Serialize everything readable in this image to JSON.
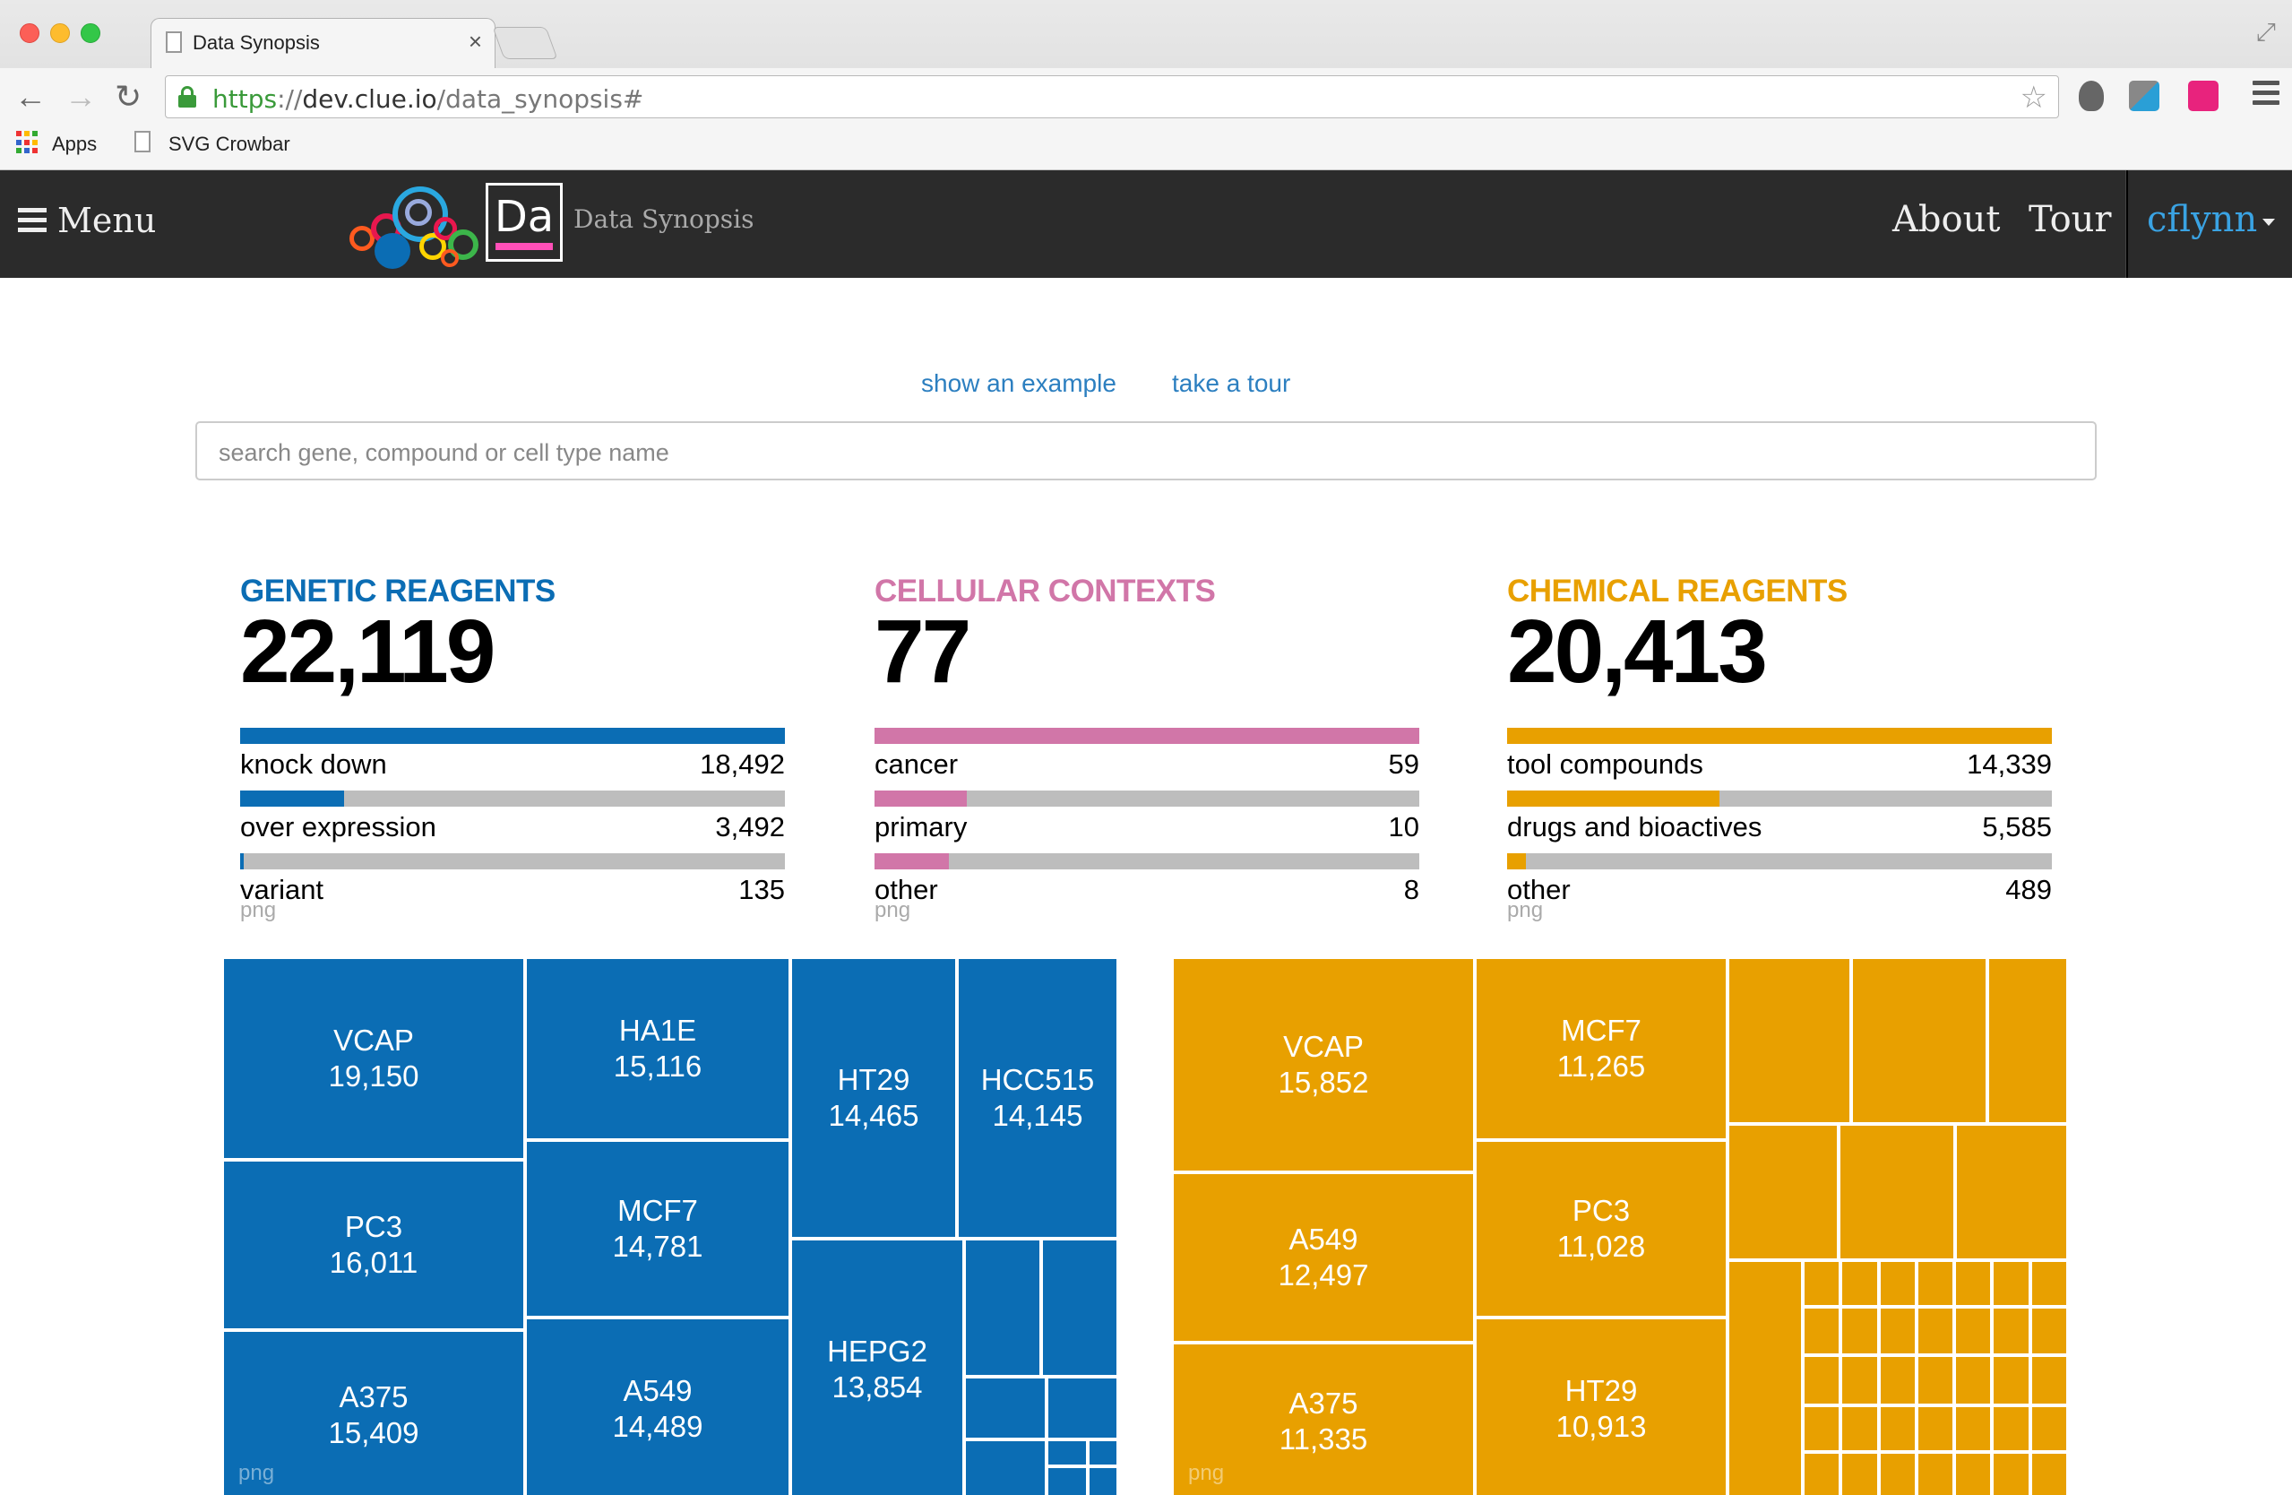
{
  "browser": {
    "tab_title": "Data Synopsis",
    "tab_close": "×",
    "url_scheme": "https",
    "url_sep": "://",
    "url_host": "dev.clue.io",
    "url_path": "/data_synopsis#",
    "bookmarks": [
      "Apps",
      "SVG Crowbar"
    ]
  },
  "navbar": {
    "menu_label": "Menu",
    "logo_text": "Da",
    "brand_label": "Data Synopsis",
    "links": [
      "About",
      "Tour"
    ],
    "user": "cflynn"
  },
  "main": {
    "show_example": "show an example",
    "take_tour": "take a tour",
    "search_placeholder": "search gene, compound or cell type name"
  },
  "colors": {
    "genetic": "#0b6db4",
    "cellular": "#d176a8",
    "chemical": "#e8a000",
    "track": "#bdbdbd"
  },
  "panels": [
    {
      "title": "GENETIC REAGENTS",
      "count": "22,119",
      "color": "#0b6db4",
      "png": "png",
      "stats": [
        {
          "label": "knock down",
          "value": "18,492",
          "fraction": 1.0
        },
        {
          "label": "over expression",
          "value": "3,492",
          "fraction": 0.19
        },
        {
          "label": "variant",
          "value": "135",
          "fraction": 0.007
        }
      ]
    },
    {
      "title": "CELLULAR CONTEXTS",
      "count": "77",
      "color": "#d176a8",
      "png": "png",
      "stats": [
        {
          "label": "cancer",
          "value": "59",
          "fraction": 1.0
        },
        {
          "label": "primary",
          "value": "10",
          "fraction": 0.17
        },
        {
          "label": "other",
          "value": "8",
          "fraction": 0.136
        }
      ]
    },
    {
      "title": "CHEMICAL REAGENTS",
      "count": "20,413",
      "color": "#e8a000",
      "png": "png",
      "stats": [
        {
          "label": "tool compounds",
          "value": "14,339",
          "fraction": 1.0
        },
        {
          "label": "drugs and bioactives",
          "value": "5,585",
          "fraction": 0.39
        },
        {
          "label": "other",
          "value": "489",
          "fraction": 0.034
        }
      ]
    }
  ],
  "treemaps": {
    "genetic": {
      "png": "png",
      "cells": [
        {
          "name": "VCAP",
          "value": "19,150"
        },
        {
          "name": "PC3",
          "value": "16,011"
        },
        {
          "name": "A375",
          "value": "15,409"
        },
        {
          "name": "HA1E",
          "value": "15,116"
        },
        {
          "name": "MCF7",
          "value": "14,781"
        },
        {
          "name": "A549",
          "value": "14,489"
        },
        {
          "name": "HT29",
          "value": "14,465"
        },
        {
          "name": "HCC515",
          "value": "14,145"
        },
        {
          "name": "HEPG2",
          "value": "13,854"
        }
      ]
    },
    "chemical": {
      "png": "png",
      "cells": [
        {
          "name": "VCAP",
          "value": "15,852"
        },
        {
          "name": "A549",
          "value": "12,497"
        },
        {
          "name": "A375",
          "value": "11,335"
        },
        {
          "name": "MCF7",
          "value": "11,265"
        },
        {
          "name": "PC3",
          "value": "11,028"
        },
        {
          "name": "HT29",
          "value": "10,913"
        }
      ]
    }
  }
}
